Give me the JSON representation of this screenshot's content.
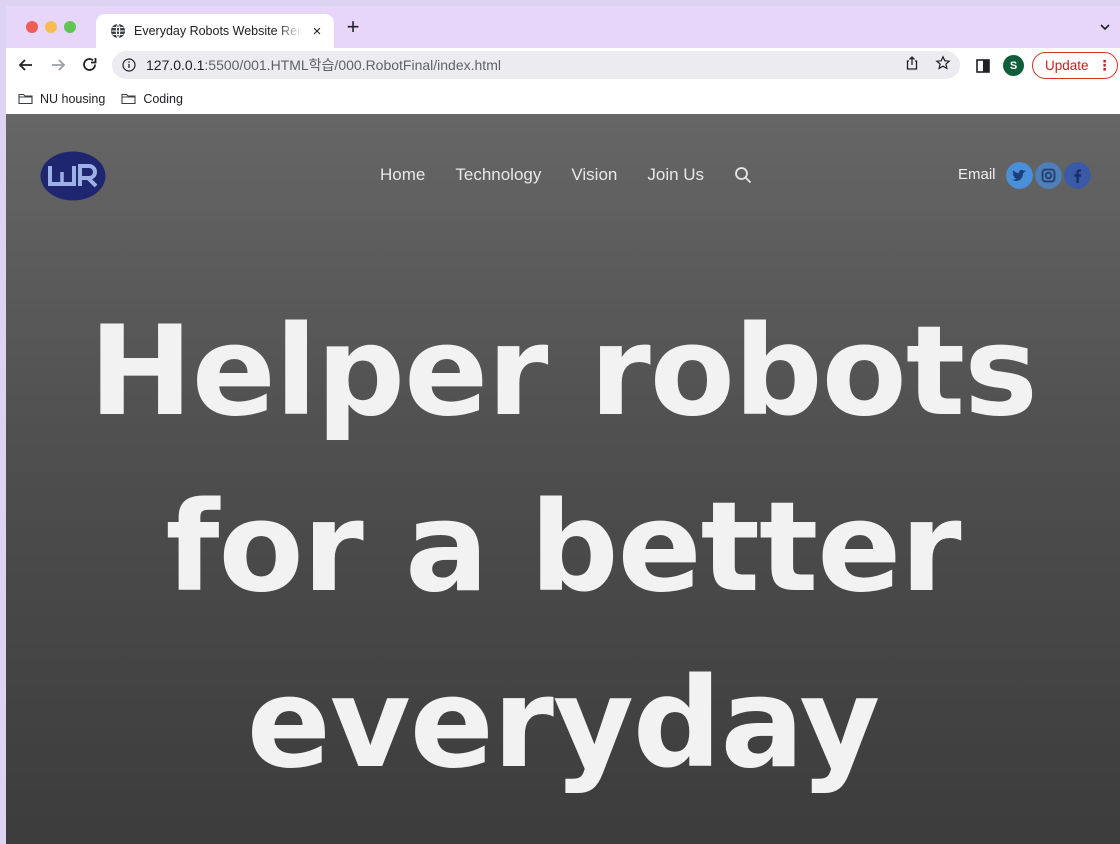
{
  "browser": {
    "tab": {
      "title": "Everyday Robots Website Rene",
      "close": "×"
    },
    "new_tab": "+",
    "url": {
      "host": "127.0.0.1",
      "path": ":5500/001.HTML학습/000.RobotFinal/index.html"
    },
    "profile_initial": "S",
    "update_label": "Update",
    "update_menu": "⋮",
    "bookmarks": [
      {
        "label": "NU housing",
        "icon": "folder-icon"
      },
      {
        "label": "Coding",
        "icon": "folder-icon"
      }
    ],
    "colors": {
      "tabstrip": "#e7d6fa",
      "update": "#c5221f",
      "avatar": "#0f5e3a"
    }
  },
  "site": {
    "logo_icon": "everyday-robots-logo",
    "nav": {
      "home": "Home",
      "technology": "Technology",
      "vision": "Vision",
      "join_us": "Join Us"
    },
    "email": "Email",
    "social": [
      "twitter-icon",
      "instagram-icon",
      "facebook-icon"
    ],
    "hero": {
      "line1": "Helper robots",
      "line2": "for a better",
      "line3": "everyday"
    },
    "colors": {
      "logo": "#1e2670",
      "social_twitter": "#4a8fd9",
      "social_instagram": "#4d7fb8",
      "social_facebook": "#3a5aa8"
    }
  }
}
